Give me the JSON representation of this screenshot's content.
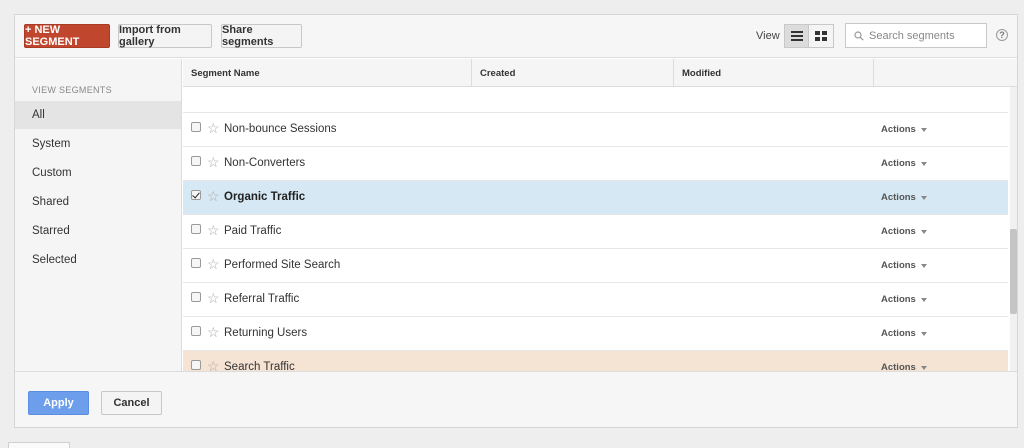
{
  "toolbar": {
    "new_segment_label": "+ NEW SEGMENT",
    "import_label": "Import from gallery",
    "share_label": "Share segments",
    "view_label": "View",
    "search_placeholder": "Search segments",
    "help_label": "?"
  },
  "sidebar": {
    "title": "VIEW SEGMENTS",
    "items": [
      {
        "label": "All",
        "active": true
      },
      {
        "label": "System"
      },
      {
        "label": "Custom"
      },
      {
        "label": "Shared"
      },
      {
        "label": "Starred"
      },
      {
        "label": "Selected"
      }
    ]
  },
  "table": {
    "columns": [
      "Segment Name",
      "Created",
      "Modified",
      ""
    ],
    "rows": [
      {
        "name": "Non-bounce Sessions",
        "checked": false,
        "action": "Actions"
      },
      {
        "name": "Non-Converters",
        "checked": false,
        "action": "Actions"
      },
      {
        "name": "Organic Traffic",
        "checked": true,
        "action": "Actions"
      },
      {
        "name": "Paid Traffic",
        "checked": false,
        "action": "Actions"
      },
      {
        "name": "Performed Site Search",
        "checked": false,
        "action": "Actions"
      },
      {
        "name": "Referral Traffic",
        "checked": false,
        "action": "Actions"
      },
      {
        "name": "Returning Users",
        "checked": false,
        "action": "Actions"
      },
      {
        "name": "Search Traffic",
        "checked": false,
        "action": "Actions",
        "hover": true
      }
    ]
  },
  "footer": {
    "apply_label": "Apply",
    "cancel_label": "Cancel"
  },
  "colors": {
    "accent_red": "#c0462e",
    "apply_blue": "#6d9eeb",
    "selected_row": "#d6e8f3",
    "hover_row": "#f5e3d3"
  }
}
